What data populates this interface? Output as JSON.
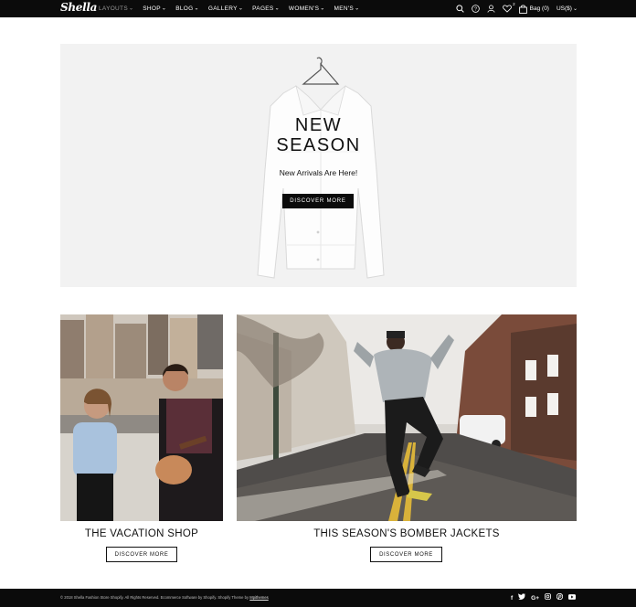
{
  "header": {
    "logo": "Shella",
    "nav": [
      {
        "label": "LAYOUTS",
        "active": false
      },
      {
        "label": "SHOP"
      },
      {
        "label": "BLOG"
      },
      {
        "label": "GALLERY"
      },
      {
        "label": "PAGES"
      },
      {
        "label": "WOMEN'S"
      },
      {
        "label": "MEN'S"
      }
    ],
    "wishlist_count": "2",
    "bag_label": "Bag (0)",
    "currency": "US($)",
    "icons": [
      "search-icon",
      "help-icon",
      "user-icon",
      "heart-icon",
      "bag-icon"
    ]
  },
  "hero": {
    "title": "NEW\nSEASON",
    "subtitle": "New Arrivals Are Here!",
    "button": "DISCOVER MORE"
  },
  "promos": [
    {
      "title": "THE VACATION SHOP",
      "button": "DISCOVER MORE"
    },
    {
      "title": "THIS SEASON'S BOMBER JACKETS",
      "button": "DISCOVER MORE"
    }
  ],
  "footer": {
    "copyright": "© 2018 Shella Fashion Store Shopify. All Rights Reserved. Ecommerce Software by Shopify. Shopify Theme by",
    "credit_link": "Mpithemes",
    "socials": [
      "f",
      "t",
      "G+",
      "ig",
      "p",
      "yt"
    ]
  },
  "colors": {
    "header_bg": "#0b0b0b",
    "hero_bg": "#f2f2f2",
    "text": "#111111"
  }
}
